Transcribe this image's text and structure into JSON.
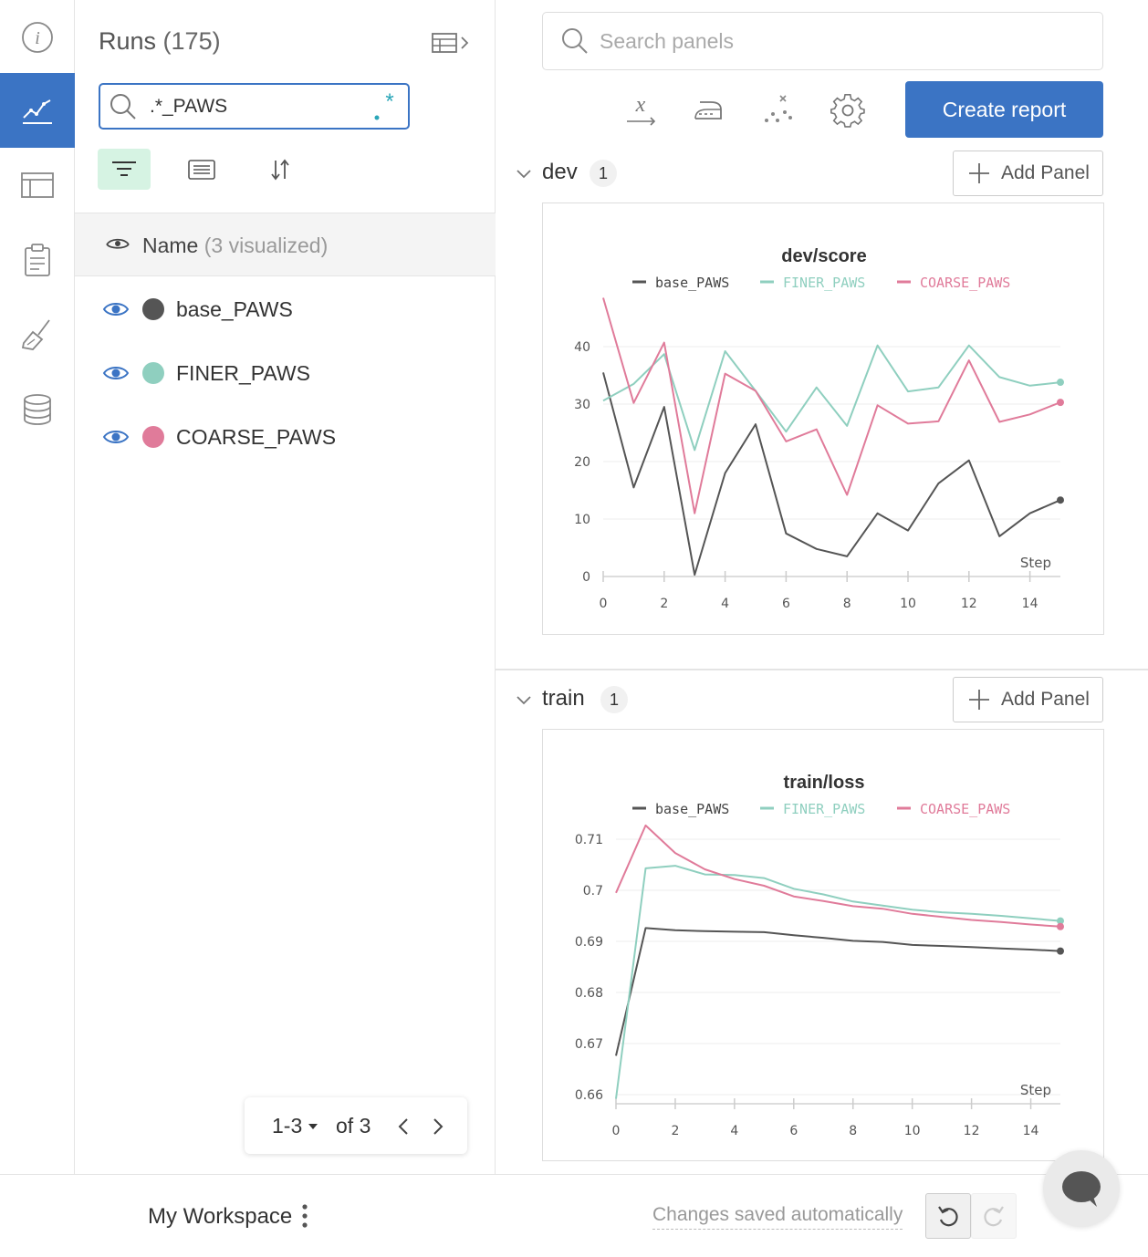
{
  "rail": {
    "items": [
      {
        "icon": "info-icon",
        "active": false
      },
      {
        "icon": "line-chart-icon",
        "active": true
      },
      {
        "icon": "table-icon",
        "active": false
      },
      {
        "icon": "clipboard-icon",
        "active": false
      },
      {
        "icon": "broom-icon",
        "active": false
      },
      {
        "icon": "database-icon",
        "active": false
      }
    ]
  },
  "runs": {
    "title": "Runs",
    "count": "(175)",
    "search_value": ".*_PAWS",
    "regex_label": ".*",
    "header_name": "Name",
    "header_visualized": "(3 visualized)",
    "items": [
      {
        "label": "base_PAWS",
        "color": "#555555"
      },
      {
        "label": "FINER_PAWS",
        "color": "#8fcfbf"
      },
      {
        "label": "COARSE_PAWS",
        "color": "#e07b9a"
      }
    ],
    "pager": {
      "range": "1-3",
      "of": "of 3"
    }
  },
  "main": {
    "search_placeholder": "Search panels",
    "create_report": "Create report",
    "sections": [
      {
        "title": "dev",
        "count": "1",
        "add_panel": "Add Panel"
      },
      {
        "title": "train",
        "count": "1",
        "add_panel": "Add Panel"
      }
    ]
  },
  "footer": {
    "workspace": "My Workspace",
    "saved": "Changes saved automatically"
  },
  "colors": {
    "accent": "#3b74c4",
    "base": "#555555",
    "finer": "#8fcfbf",
    "coarse": "#e07b9a"
  },
  "chart_data": [
    {
      "type": "line",
      "title": "dev/score",
      "xlabel": "Step",
      "ylabel": "",
      "xlim": [
        0,
        15
      ],
      "ylim": [
        0,
        40
      ],
      "xticks": [
        0,
        2,
        4,
        6,
        8,
        10,
        12,
        14
      ],
      "yticks": [
        0,
        10,
        20,
        30,
        40
      ],
      "x": [
        0,
        1,
        2,
        3,
        4,
        5,
        6,
        7,
        8,
        9,
        10,
        11,
        12,
        13,
        14,
        15
      ],
      "series": [
        {
          "name": "base_PAWS",
          "values": [
            35.5,
            15.5,
            29.5,
            0.3,
            18,
            26.5,
            7.5,
            4.8,
            3.5,
            11,
            8,
            16.2,
            20.2,
            7,
            11,
            13.3
          ]
        },
        {
          "name": "FINER_PAWS",
          "values": [
            30.6,
            33.5,
            38.7,
            22,
            39.2,
            32.3,
            25.2,
            32.9,
            26.2,
            40.2,
            32.2,
            32.9,
            40.2,
            34.7,
            33.2,
            33.8
          ]
        },
        {
          "name": "COARSE_PAWS",
          "values": [
            48.5,
            30.2,
            40.7,
            11,
            35.3,
            32.3,
            23.5,
            25.6,
            14.2,
            29.8,
            26.6,
            27,
            37.6,
            26.9,
            28.2,
            30.3
          ]
        }
      ],
      "legend": "top",
      "grid": true
    },
    {
      "type": "line",
      "title": "train/loss",
      "xlabel": "Step",
      "ylabel": "",
      "xlim": [
        0,
        15
      ],
      "ylim": [
        0.66,
        0.71
      ],
      "xticks": [
        0,
        2,
        4,
        6,
        8,
        10,
        12,
        14
      ],
      "yticks": [
        0.66,
        0.67,
        0.68,
        0.69,
        0.7,
        0.71
      ],
      "ytick_labels": [
        "0.66",
        "0.67",
        "0.68",
        "0.69",
        "0.7",
        "0.71"
      ],
      "x": [
        0,
        1,
        2,
        3,
        4,
        5,
        6,
        7,
        8,
        9,
        10,
        11,
        12,
        13,
        14,
        15
      ],
      "series": [
        {
          "name": "base_PAWS",
          "values": [
            0.6676,
            0.6926,
            0.6922,
            0.692,
            0.6919,
            0.6918,
            0.6912,
            0.6907,
            0.6901,
            0.6899,
            0.6893,
            0.6891,
            0.6889,
            0.6886,
            0.6884,
            0.6881
          ]
        },
        {
          "name": "FINER_PAWS",
          "values": [
            0.6592,
            0.7043,
            0.7048,
            0.7031,
            0.703,
            0.7024,
            0.7003,
            0.6992,
            0.6978,
            0.697,
            0.6962,
            0.6957,
            0.6954,
            0.695,
            0.6945,
            0.694
          ]
        },
        {
          "name": "COARSE_PAWS",
          "values": [
            0.6995,
            0.7127,
            0.7073,
            0.7041,
            0.7022,
            0.7009,
            0.6988,
            0.6979,
            0.6969,
            0.6964,
            0.6954,
            0.6948,
            0.6942,
            0.6938,
            0.6933,
            0.6929
          ]
        }
      ],
      "legend": "top",
      "grid": true
    }
  ]
}
